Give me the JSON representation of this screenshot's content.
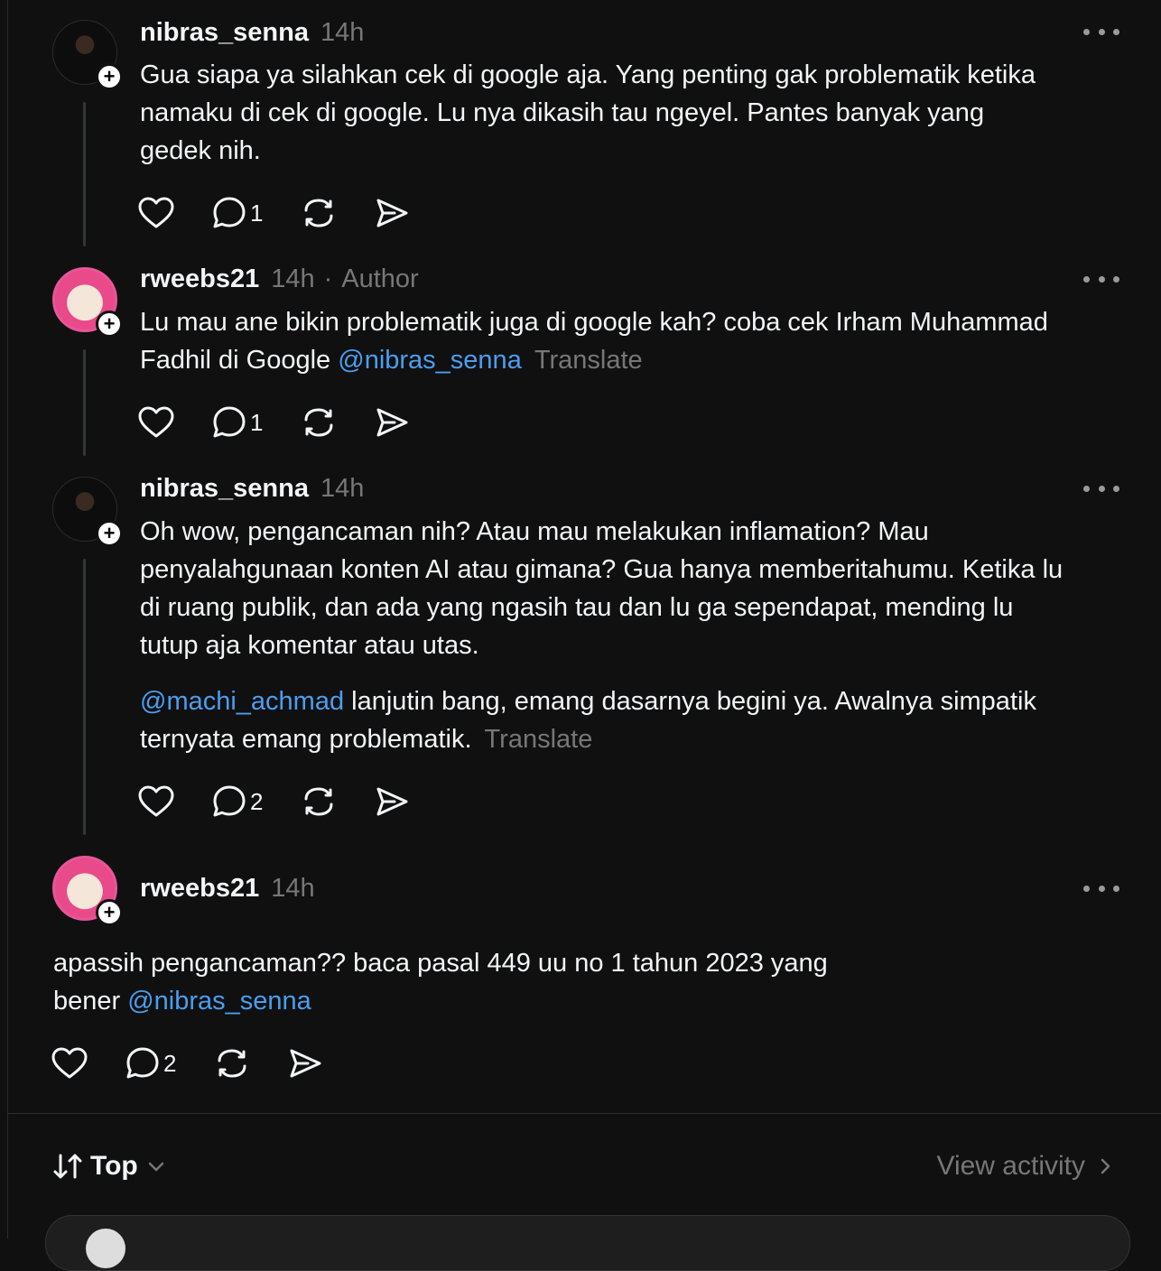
{
  "posts": [
    {
      "username": "nibras_senna",
      "time": "14h",
      "paragraphs": [
        [
          {
            "t": "Gua siapa ya silahkan cek di google aja. Yang penting gak problematik ketika"
          }
        ],
        [
          {
            "t": "namaku di cek di google. Lu nya dikasih tau ngeyel. Pantes banyak yang"
          }
        ],
        [
          {
            "t": "gedek nih."
          }
        ]
      ],
      "reply_count": "1"
    },
    {
      "username": "rweebs21",
      "time": "14h",
      "separator": "·",
      "author_label": "Author",
      "text_line1": "Lu mau ane bikin problematik juga di google kah? coba cek Irham Muhammad",
      "text_line2": "Fadhil di Google ",
      "mention": "@nibras_senna",
      "translate": "Translate",
      "reply_count": "1"
    },
    {
      "username": "nibras_senna",
      "time": "14h",
      "lines": [
        "Oh wow, pengancaman nih? Atau mau melakukan inflamation? Mau",
        "penyalahgunaan konten AI atau gimana? Gua hanya memberitahumu. Ketika lu",
        "di ruang publik, dan ada yang ngasih tau dan lu ga sependapat, mending lu",
        "tutup aja komentar atau utas."
      ],
      "mention": "@machi_achmad",
      "line5_rest": " lanjutin bang, emang dasarnya begini ya. Awalnya simpatik",
      "line6": "ternyata emang problematik.",
      "translate": "Translate",
      "reply_count": "2"
    },
    {
      "username": "rweebs21",
      "time": "14h",
      "line1": "apassih pengancaman?? baca pasal 449 uu no 1 tahun 2023 yang",
      "line2": "bener ",
      "mention": "@nibras_senna",
      "reply_count": "2"
    }
  ],
  "footer": {
    "sort_label": "Top",
    "view_activity": "View activity"
  },
  "icons": [
    "plus-icon",
    "more-icon",
    "heart-icon",
    "comment-icon",
    "repost-icon",
    "share-icon",
    "sort-icon",
    "chevron-down-icon",
    "chevron-right-icon"
  ],
  "colors": {
    "background": "#101010",
    "mention": "#4a9ef0",
    "muted": "#777777"
  }
}
